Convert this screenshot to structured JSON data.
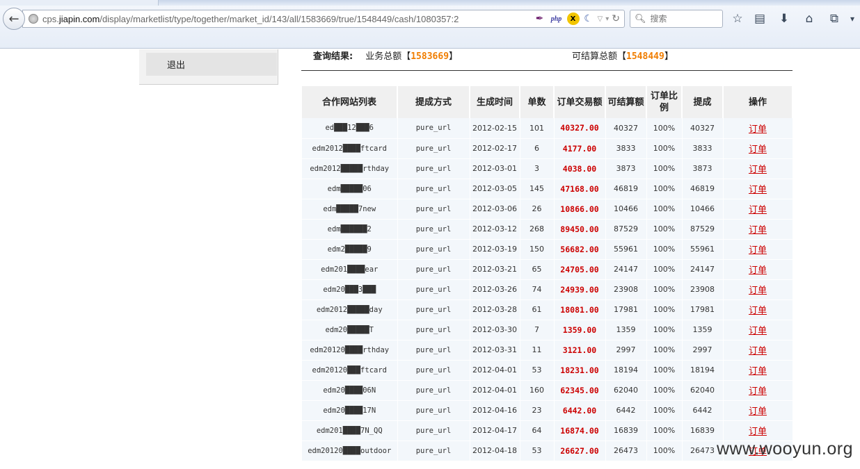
{
  "browser": {
    "url_prefix": "cps.",
    "url_domain": "jiapin.com",
    "url_path": "/display/marketlist/type/together/market_id/143/all/1583669/true/1548449/cash/1080357:2",
    "addon_php": "php",
    "addon_x": "X",
    "search_placeholder": "搜索"
  },
  "sidebar": {
    "logout_label": "退出"
  },
  "summary": {
    "query_label": "查询结果:",
    "business_label": "业务总额",
    "business_value": "1583669",
    "settle_label": "可结算总额",
    "settle_value": "1548449",
    "bracket_open": "【",
    "bracket_close": "】"
  },
  "table": {
    "headers": [
      "合作网站列表",
      "提成方式",
      "生成时间",
      "单数",
      "订单交易额",
      "可结算额",
      "订单比例",
      "提成",
      "操作"
    ],
    "rows": [
      {
        "site": "ed███12███6",
        "method": "pure_url",
        "date": "2012-02-15",
        "count": "101",
        "amount": "40327.00",
        "settle": "40327",
        "ratio": "100%",
        "commission": "40327",
        "op": "订单"
      },
      {
        "site": "edm2012████ftcard",
        "method": "pure_url",
        "date": "2012-02-17",
        "count": "6",
        "amount": "4177.00",
        "settle": "3833",
        "ratio": "100%",
        "commission": "3833",
        "op": "订单"
      },
      {
        "site": "edm2012█████rthday",
        "method": "pure_url",
        "date": "2012-03-01",
        "count": "3",
        "amount": "4038.00",
        "settle": "3873",
        "ratio": "100%",
        "commission": "3873",
        "op": "订单"
      },
      {
        "site": "edm█████06",
        "method": "pure_url",
        "date": "2012-03-05",
        "count": "145",
        "amount": "47168.00",
        "settle": "46819",
        "ratio": "100%",
        "commission": "46819",
        "op": "订单"
      },
      {
        "site": "edm█████7new",
        "method": "pure_url",
        "date": "2012-03-06",
        "count": "26",
        "amount": "10866.00",
        "settle": "10466",
        "ratio": "100%",
        "commission": "10466",
        "op": "订单"
      },
      {
        "site": "edm██████2",
        "method": "pure_url",
        "date": "2012-03-12",
        "count": "268",
        "amount": "89450.00",
        "settle": "87529",
        "ratio": "100%",
        "commission": "87529",
        "op": "订单"
      },
      {
        "site": "edm2█████9",
        "method": "pure_url",
        "date": "2012-03-19",
        "count": "150",
        "amount": "56682.00",
        "settle": "55961",
        "ratio": "100%",
        "commission": "55961",
        "op": "订单"
      },
      {
        "site": "edm201████ear",
        "method": "pure_url",
        "date": "2012-03-21",
        "count": "65",
        "amount": "24705.00",
        "settle": "24147",
        "ratio": "100%",
        "commission": "24147",
        "op": "订单"
      },
      {
        "site": "edm20███3███",
        "method": "pure_url",
        "date": "2012-03-26",
        "count": "74",
        "amount": "24939.00",
        "settle": "23908",
        "ratio": "100%",
        "commission": "23908",
        "op": "订单"
      },
      {
        "site": "edm2012█████day",
        "method": "pure_url",
        "date": "2012-03-28",
        "count": "61",
        "amount": "18081.00",
        "settle": "17981",
        "ratio": "100%",
        "commission": "17981",
        "op": "订单"
      },
      {
        "site": "edm20█████T",
        "method": "pure_url",
        "date": "2012-03-30",
        "count": "7",
        "amount": "1359.00",
        "settle": "1359",
        "ratio": "100%",
        "commission": "1359",
        "op": "订单"
      },
      {
        "site": "edm20120████rthday",
        "method": "pure_url",
        "date": "2012-03-31",
        "count": "11",
        "amount": "3121.00",
        "settle": "2997",
        "ratio": "100%",
        "commission": "2997",
        "op": "订单"
      },
      {
        "site": "edm20120███ftcard",
        "method": "pure_url",
        "date": "2012-04-01",
        "count": "53",
        "amount": "18231.00",
        "settle": "18194",
        "ratio": "100%",
        "commission": "18194",
        "op": "订单"
      },
      {
        "site": "edm20████06N",
        "method": "pure_url",
        "date": "2012-04-01",
        "count": "160",
        "amount": "62345.00",
        "settle": "62040",
        "ratio": "100%",
        "commission": "62040",
        "op": "订单"
      },
      {
        "site": "edm20████17N",
        "method": "pure_url",
        "date": "2012-04-16",
        "count": "23",
        "amount": "6442.00",
        "settle": "6442",
        "ratio": "100%",
        "commission": "6442",
        "op": "订单"
      },
      {
        "site": "edm201████7N_QQ",
        "method": "pure_url",
        "date": "2012-04-17",
        "count": "64",
        "amount": "16874.00",
        "settle": "16839",
        "ratio": "100%",
        "commission": "16839",
        "op": "订单"
      },
      {
        "site": "edm20120████outdoor",
        "method": "pure_url",
        "date": "2012-04-18",
        "count": "53",
        "amount": "26627.00",
        "settle": "26473",
        "ratio": "100%",
        "commission": "26473",
        "op": "订单"
      }
    ]
  },
  "watermark": "www.wooyun.org"
}
